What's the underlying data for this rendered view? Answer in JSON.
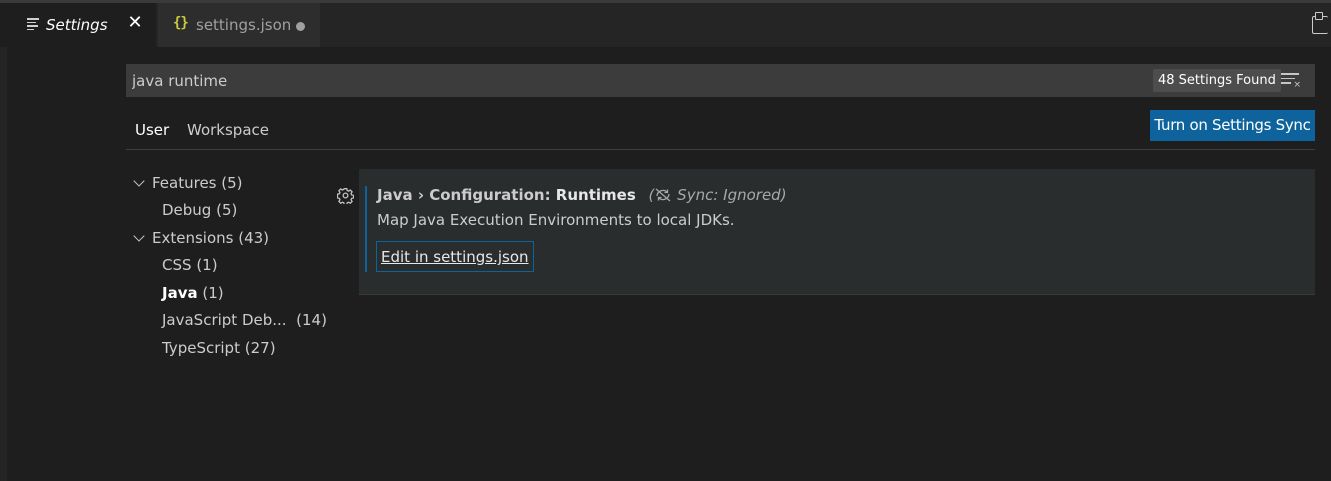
{
  "tabs": {
    "settings_label": "Settings",
    "settings_close": "✕",
    "json_label": "settings.json",
    "json_icon": "{}"
  },
  "search": {
    "value": "java runtime",
    "results_badge": "48 Settings Found"
  },
  "scope": {
    "user_label": "User",
    "workspace_label": "Workspace",
    "sync_button_label": "Turn on Settings Sync"
  },
  "toc": {
    "features": {
      "name": "Features",
      "count": "(5)"
    },
    "debug": {
      "name": "Debug",
      "count": "(5)"
    },
    "extensions": {
      "name": "Extensions",
      "count": "(43)"
    },
    "css": {
      "name": "CSS",
      "count": "(1)"
    },
    "java": {
      "name": "Java",
      "count": "(1)"
    },
    "javascript_debugger": {
      "name": "JavaScript Deb...",
      "count": "(14)"
    },
    "typescript": {
      "name": "TypeScript",
      "count": "(27)"
    }
  },
  "setting": {
    "category": "Java › Configuration: ",
    "key": "Runtimes",
    "sync_status": "Sync: Ignored",
    "description": "Map Java Execution Environments to local JDKs.",
    "edit_link": "Edit in settings.json"
  },
  "colors": {
    "accent": "#0e639c",
    "background": "#1e1e1e",
    "json_icon": "#cbcb41"
  }
}
